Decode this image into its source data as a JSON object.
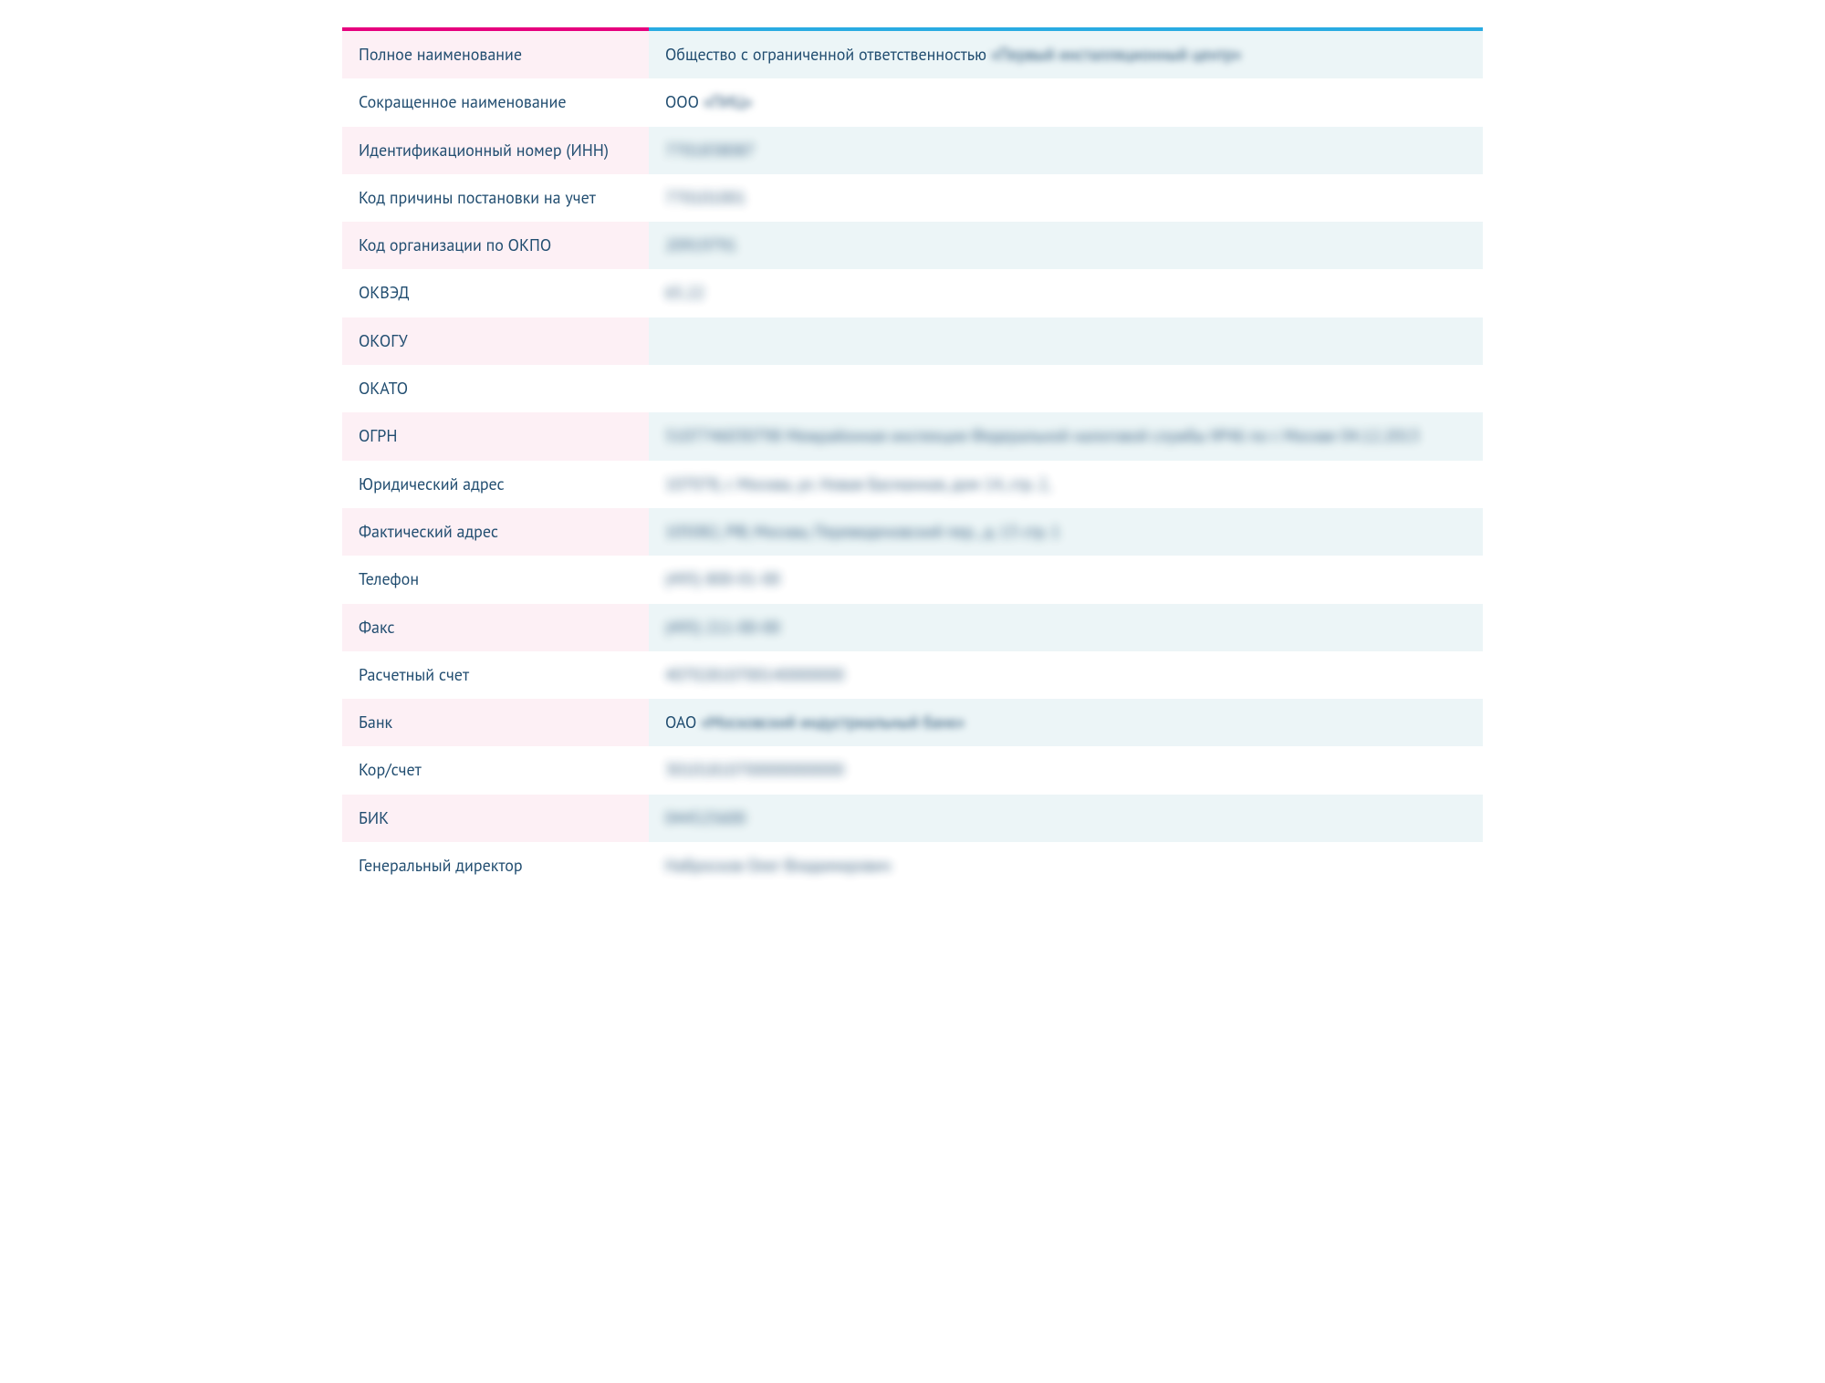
{
  "rows": [
    {
      "label": "Полное наименование",
      "prefix": "Общество с ограниченной ответственностью ",
      "blurred": "«Первый инсталляционный центр»",
      "blurClass": "blur"
    },
    {
      "label": "Сокращенное наименование",
      "prefix": "ООО ",
      "blurred": "«ПИЦ»",
      "blurClass": "blur"
    },
    {
      "label": "Идентификационный номер (ИНН)",
      "prefix": "",
      "blurred": "7701838087",
      "blurClass": "blur-light"
    },
    {
      "label": "Код причины постановки на учет",
      "prefix": "",
      "blurred": "770101001",
      "blurClass": "blur-light"
    },
    {
      "label": "Код организации по ОКПО",
      "prefix": "",
      "blurred": "20919791",
      "blurClass": "blur-light"
    },
    {
      "label": "ОКВЭД",
      "prefix": "",
      "blurred": "65.22",
      "blurClass": "blur-light"
    },
    {
      "label": "ОКОГУ",
      "prefix": "",
      "blurred": "",
      "blurClass": "blur-light"
    },
    {
      "label": "ОКАТО",
      "prefix": "",
      "blurred": "",
      "blurClass": "blur-light"
    },
    {
      "label": "ОГРН",
      "prefix": "",
      "blurred": "5107746030798  Межрайонная инспекция Федеральной налоговой службы №46 по г. Москве 04.12.2013",
      "blurClass": "blur-light"
    },
    {
      "label": "Юридический адрес",
      "prefix": "",
      "blurred": "107078, г. Москва, ул. Новая Басманная, дом 14, стр. 2,",
      "blurClass": "blur-light"
    },
    {
      "label": "Фактический адрес",
      "prefix": "",
      "blurred": "105082, РФ, Москва, Переведеновский пер., д. 13 стр. 1",
      "blurClass": "blur-light"
    },
    {
      "label": "Телефон",
      "prefix": "",
      "blurred": "(495) 800-01-00",
      "blurClass": "blur-light"
    },
    {
      "label": "Факс",
      "prefix": "",
      "blurred": "(495) 211-00-00",
      "blurClass": "blur-light"
    },
    {
      "label": "Расчетный счет",
      "prefix": "",
      "blurred": "40702810700140000000",
      "blurClass": "blur-light"
    },
    {
      "label": "Банк",
      "prefix": "ОАО ",
      "blurred": "«Московский индустриальный банк»",
      "blurClass": "blur"
    },
    {
      "label": "Кор/счет",
      "prefix": "",
      "blurred": "30101810700000000000",
      "blurClass": "blur-light"
    },
    {
      "label": "БИК",
      "prefix": "",
      "blurred": "044525600",
      "blurClass": "blur-light"
    },
    {
      "label": "Генеральный директор",
      "prefix": "",
      "blurred": "Набросков Олег Владимирович",
      "blurClass": "blur-light"
    }
  ]
}
